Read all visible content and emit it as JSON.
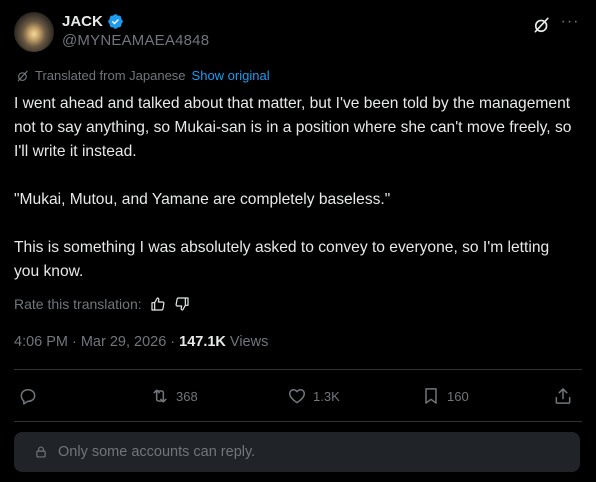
{
  "author": {
    "display_name": "JACK",
    "handle": "@MYNEAMAEA4848"
  },
  "icons": {
    "verified": "verified-badge-icon",
    "grok": "grok-icon",
    "more": "more-icon",
    "translate": "translate-icon",
    "thumbs_up": "thumbs-up-icon",
    "thumbs_down": "thumbs-down-icon",
    "reply": "reply-icon",
    "retweet": "retweet-icon",
    "like": "heart-icon",
    "bookmark": "bookmark-icon",
    "share": "share-icon",
    "lock": "lock-icon"
  },
  "translation": {
    "label": "Translated from Japanese",
    "show_original": "Show original"
  },
  "tweet": {
    "text": "I went ahead and talked about that matter, but I've been told by the management not to say anything, so Mukai-san is in a position where she can't move freely, so I'll write it instead.\n\n\"Mukai, Mutou, and Yamane are completely baseless.\"\n\nThis is something I was absolutely asked to convey to everyone, so I'm letting you know."
  },
  "rate": {
    "label": "Rate this translation:"
  },
  "meta": {
    "time": "4:06 PM",
    "separator1": "·",
    "date": "Mar 29, 2026",
    "separator2": "·",
    "views_count": "147.1K",
    "views_label": "Views"
  },
  "actions": {
    "retweets": "368",
    "likes": "1.3K",
    "bookmarks": "160"
  },
  "reply_restriction": {
    "text": "Only some accounts can reply."
  },
  "colors": {
    "background": "#000000",
    "text": "#e7e9ea",
    "muted": "#71767b",
    "accent": "#1d9bf0",
    "divider": "#2f3336",
    "reply_box": "#202327"
  }
}
